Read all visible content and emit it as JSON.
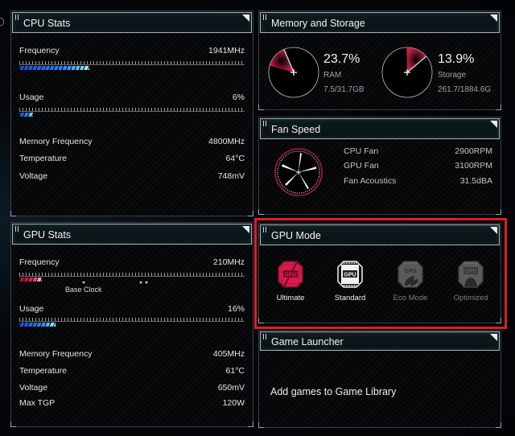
{
  "cpu_stats": {
    "title": "CPU Stats",
    "frequency": {
      "label": "Frequency",
      "value": "1941MHz",
      "fill_fraction": 0.31
    },
    "usage": {
      "label": "Usage",
      "value": "6%",
      "fill_fraction": 0.06
    },
    "rows": [
      {
        "label": "Memory Frequency",
        "value": "4800MHz"
      },
      {
        "label": "Temperature",
        "value": "64°C"
      },
      {
        "label": "Voltage",
        "value": "748mV"
      }
    ]
  },
  "gpu_stats": {
    "title": "GPU Stats",
    "frequency": {
      "label": "Frequency",
      "value": "210MHz",
      "fill_fraction": 0.1,
      "marker_label": "Base Clock"
    },
    "usage": {
      "label": "Usage",
      "value": "16%",
      "fill_fraction": 0.16
    },
    "rows": [
      {
        "label": "Memory Frequency",
        "value": "405MHz"
      },
      {
        "label": "Temperature",
        "value": "61°C"
      },
      {
        "label": "Voltage",
        "value": "650mV"
      },
      {
        "label": "Max TGP",
        "value": "120W"
      }
    ]
  },
  "memory_storage": {
    "title": "Memory and Storage",
    "ram": {
      "percent": "23.7%",
      "percent_value": 23.7,
      "label": "RAM",
      "detail": "7.5/31.7GB"
    },
    "storage": {
      "percent": "13.9%",
      "percent_value": 13.9,
      "label": "Storage",
      "detail": "261.7/1884.6G"
    }
  },
  "fan_speed": {
    "title": "Fan Speed",
    "rows": [
      {
        "label": "CPU Fan",
        "value": "2900RPM"
      },
      {
        "label": "GPU Fan",
        "value": "3100RPM"
      },
      {
        "label": "Fan Acoustics",
        "value": "31.5dBA"
      }
    ]
  },
  "gpu_mode": {
    "title": "GPU Mode",
    "chip_text": "GPU",
    "modes": [
      {
        "label": "Ultimate",
        "icon": "gpu-ultimate-icon",
        "state": "selected"
      },
      {
        "label": "Standard",
        "icon": "gpu-standard-icon",
        "state": "available"
      },
      {
        "label": "Eco Mode",
        "icon": "gpu-eco-icon",
        "state": "dimmed"
      },
      {
        "label": "Optimized",
        "icon": "gpu-optimized-icon",
        "state": "dimmed"
      }
    ]
  },
  "game_launcher": {
    "title": "Game Launcher",
    "message": "Add games to Game Library"
  },
  "colors": {
    "accent_red": "#e0264f",
    "highlight_box": "#e31b23",
    "bar_blue": "#2d7ef0",
    "bar_cyan": "#5fd2f5"
  }
}
